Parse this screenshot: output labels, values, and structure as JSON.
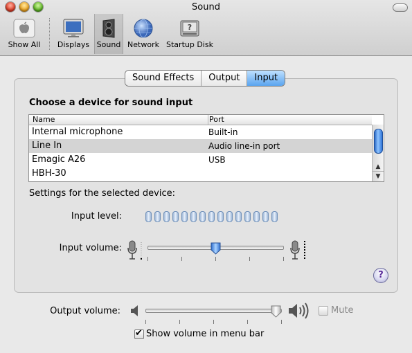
{
  "window": {
    "title": "Sound"
  },
  "toolbar": {
    "items": [
      {
        "label": "Show All",
        "icon": "apple-icon"
      },
      {
        "label": "Displays",
        "icon": "display-icon"
      },
      {
        "label": "Sound",
        "icon": "speaker-icon",
        "selected": true
      },
      {
        "label": "Network",
        "icon": "globe-icon"
      },
      {
        "label": "Startup Disk",
        "icon": "hard-disk-icon"
      }
    ]
  },
  "tabs": [
    {
      "label": "Sound Effects",
      "active": false
    },
    {
      "label": "Output",
      "active": false
    },
    {
      "label": "Input",
      "active": true
    }
  ],
  "input": {
    "heading": "Choose a device for sound input",
    "columns": {
      "name": "Name",
      "port": "Port"
    },
    "devices": [
      {
        "name": "Internal microphone",
        "port": "Built-in",
        "selected": false
      },
      {
        "name": "Line In",
        "port": "Audio line-in port",
        "selected": true
      },
      {
        "name": "Emagic A26",
        "port": "USB",
        "selected": false
      },
      {
        "name": "HBH-30",
        "port": "",
        "selected": false
      }
    ],
    "settings_label": "Settings for the selected device:",
    "input_level_label": "Input level:",
    "input_level_segments": 15,
    "input_level_lit": 0,
    "input_volume_label": "Input volume:",
    "input_volume_fraction": 0.5
  },
  "output": {
    "volume_label": "Output volume:",
    "volume_fraction": 1.0,
    "mute_label": "Mute",
    "mute_checked": false,
    "menu_bar_label": "Show volume in menu bar",
    "menu_bar_checked": true
  },
  "help": {
    "symbol": "?"
  },
  "colors": {
    "accent": "#3d86e0",
    "selected_row": "#d4d4d4",
    "help_glyph": "#5a2c9a"
  }
}
